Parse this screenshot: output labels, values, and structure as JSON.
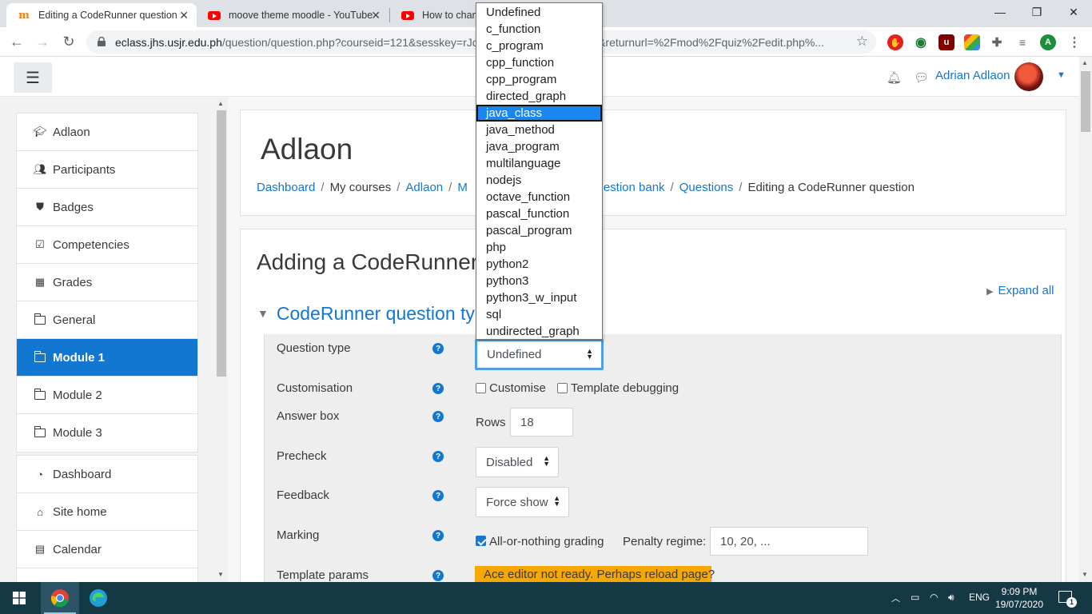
{
  "browser": {
    "tabs": [
      {
        "title": "Editing a CodeRunner question",
        "icon": "moodle-icon",
        "active": true
      },
      {
        "title": "moove theme moodle - YouTube",
        "icon": "youtube-icon",
        "active": false
      },
      {
        "title": "How to chang",
        "icon": "youtube-icon",
        "active": false
      }
    ],
    "url_host": "eclass.jhs.usjr.edu.ph",
    "url_path": "/question/question.php?courseid=121&sesskey=rJoV",
    "url_tail": "ner&returnurl=%2Fmod%2Fquiz%2Fedit.php%...",
    "profile_initial": "A"
  },
  "header": {
    "user_name": "Adrian Adlaon"
  },
  "drawer": {
    "course_items": [
      {
        "label": "Adlaon",
        "icon": "graduation-cap-icon"
      },
      {
        "label": "Participants",
        "icon": "users-icon"
      },
      {
        "label": "Badges",
        "icon": "shield-icon"
      },
      {
        "label": "Competencies",
        "icon": "check-square-icon"
      },
      {
        "label": "Grades",
        "icon": "table-icon"
      },
      {
        "label": "General",
        "icon": "folder-icon"
      },
      {
        "label": "Module 1",
        "icon": "folder-icon",
        "active": true
      },
      {
        "label": "Module 2",
        "icon": "folder-icon"
      },
      {
        "label": "Module 3",
        "icon": "folder-icon"
      }
    ],
    "site_items": [
      {
        "label": "Dashboard",
        "icon": "dashboard-icon"
      },
      {
        "label": "Site home",
        "icon": "home-icon"
      },
      {
        "label": "Calendar",
        "icon": "calendar-icon"
      }
    ]
  },
  "page": {
    "title": "Adlaon",
    "breadcrumb": [
      "Dashboard",
      "My courses",
      "Adlaon",
      "M",
      "Question bank",
      "Questions",
      "Editing a CodeRunner question"
    ],
    "form_title": "Adding a CodeRunner",
    "expand_all": "Expand all",
    "section_title": "CodeRunner question ty"
  },
  "form": {
    "question_type": {
      "label": "Question type",
      "value": "Undefined"
    },
    "customisation": {
      "label": "Customisation",
      "customise": "Customise",
      "template_debugging": "Template debugging"
    },
    "answer_box": {
      "label": "Answer box",
      "rows_label": "Rows",
      "rows_value": "18"
    },
    "precheck": {
      "label": "Precheck",
      "value": "Disabled"
    },
    "feedback": {
      "label": "Feedback",
      "value": "Force show"
    },
    "marking": {
      "label": "Marking",
      "all_or_nothing": "All-or-nothing grading",
      "all_or_nothing_checked": true,
      "penalty_label": "Penalty regime:",
      "penalty_value": "10, 20, ..."
    },
    "template_params": {
      "label": "Template params",
      "warning": "Ace editor not ready. Perhaps reload page?"
    }
  },
  "dropdown": {
    "options": [
      "Undefined",
      "c_function",
      "c_program",
      "cpp_function",
      "cpp_program",
      "directed_graph",
      "java_class",
      "java_method",
      "java_program",
      "multilanguage",
      "nodejs",
      "octave_function",
      "pascal_function",
      "pascal_program",
      "php",
      "python2",
      "python3",
      "python3_w_input",
      "sql",
      "undirected_graph"
    ],
    "highlighted": "java_class"
  },
  "taskbar": {
    "language": "ENG",
    "time": "9:09 PM",
    "date": "19/07/2020",
    "notification_count": "1"
  },
  "colors": {
    "accent": "#1177d1",
    "warning": "#f6a800",
    "taskbar": "#153845"
  }
}
